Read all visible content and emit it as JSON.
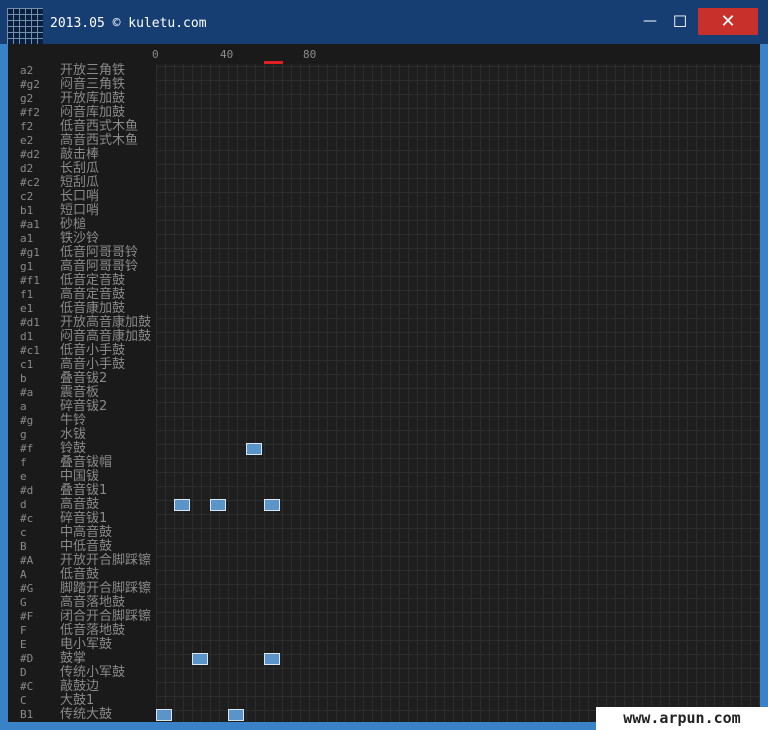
{
  "window": {
    "title": "2013.05 © kuletu.com",
    "icon": "grid-app-icon",
    "controls": {
      "minimize": "—",
      "maximize": "☐",
      "close": "✕"
    }
  },
  "ruler": {
    "labels": [
      "0",
      "40",
      "80"
    ]
  },
  "rows": [
    {
      "note": "a2",
      "instrument": "开放三角铁"
    },
    {
      "note": "#g2",
      "instrument": "闷音三角铁"
    },
    {
      "note": "g2",
      "instrument": "开放库加鼓"
    },
    {
      "note": "#f2",
      "instrument": "闷音库加鼓"
    },
    {
      "note": "f2",
      "instrument": "低音西式木鱼"
    },
    {
      "note": "e2",
      "instrument": "高音西式木鱼"
    },
    {
      "note": "#d2",
      "instrument": "敲击棒"
    },
    {
      "note": "d2",
      "instrument": "长刮瓜"
    },
    {
      "note": "#c2",
      "instrument": "短刮瓜"
    },
    {
      "note": "c2",
      "instrument": "长口哨"
    },
    {
      "note": "b1",
      "instrument": "短口哨"
    },
    {
      "note": "#a1",
      "instrument": "砂槌"
    },
    {
      "note": "a1",
      "instrument": "铁沙铃"
    },
    {
      "note": "#g1",
      "instrument": "低音阿哥哥铃"
    },
    {
      "note": "g1",
      "instrument": "高音阿哥哥铃"
    },
    {
      "note": "#f1",
      "instrument": "低音定音鼓"
    },
    {
      "note": "f1",
      "instrument": "高音定音鼓"
    },
    {
      "note": "e1",
      "instrument": "低音康加鼓"
    },
    {
      "note": "#d1",
      "instrument": "开放高音康加鼓"
    },
    {
      "note": "d1",
      "instrument": "闷音高音康加鼓"
    },
    {
      "note": "#c1",
      "instrument": "低音小手鼓"
    },
    {
      "note": "c1",
      "instrument": "高音小手鼓"
    },
    {
      "note": "b",
      "instrument": "叠音钹2"
    },
    {
      "note": "#a",
      "instrument": "震音板"
    },
    {
      "note": "a",
      "instrument": "碎音钹2"
    },
    {
      "note": "#g",
      "instrument": "牛铃"
    },
    {
      "note": "g",
      "instrument": "水钹"
    },
    {
      "note": "#f",
      "instrument": "铃鼓"
    },
    {
      "note": "f",
      "instrument": "叠音钹帽"
    },
    {
      "note": "e",
      "instrument": "中国钹"
    },
    {
      "note": "#d",
      "instrument": "叠音钹1"
    },
    {
      "note": "d",
      "instrument": "高音鼓"
    },
    {
      "note": "#c",
      "instrument": "碎音钹1"
    },
    {
      "note": "c",
      "instrument": "中高音鼓"
    },
    {
      "note": "B",
      "instrument": "中低音鼓"
    },
    {
      "note": "#A",
      "instrument": "开放开合脚踩镲"
    },
    {
      "note": "A",
      "instrument": "低音鼓"
    },
    {
      "note": "#G",
      "instrument": "脚踏开合脚踩镲"
    },
    {
      "note": "G",
      "instrument": "高音落地鼓"
    },
    {
      "note": "#F",
      "instrument": "闭合开合脚踩镲"
    },
    {
      "note": "F",
      "instrument": "低音落地鼓"
    },
    {
      "note": "E",
      "instrument": "电小军鼓"
    },
    {
      "note": "#D",
      "instrument": "鼓掌"
    },
    {
      "note": "D",
      "instrument": "传统小军鼓"
    },
    {
      "note": "#C",
      "instrument": "敲鼓边"
    },
    {
      "note": "C",
      "instrument": "大鼓1"
    },
    {
      "note": "B1",
      "instrument": "传统大鼓"
    }
  ],
  "beats": [
    {
      "row": 27,
      "step": 10
    },
    {
      "row": 31,
      "step": 2
    },
    {
      "row": 31,
      "step": 6
    },
    {
      "row": 31,
      "step": 12
    },
    {
      "row": 42,
      "step": 4
    },
    {
      "row": 42,
      "step": 12
    },
    {
      "row": 46,
      "step": 0
    },
    {
      "row": 46,
      "step": 8
    }
  ],
  "watermark": "www.arpun.com"
}
